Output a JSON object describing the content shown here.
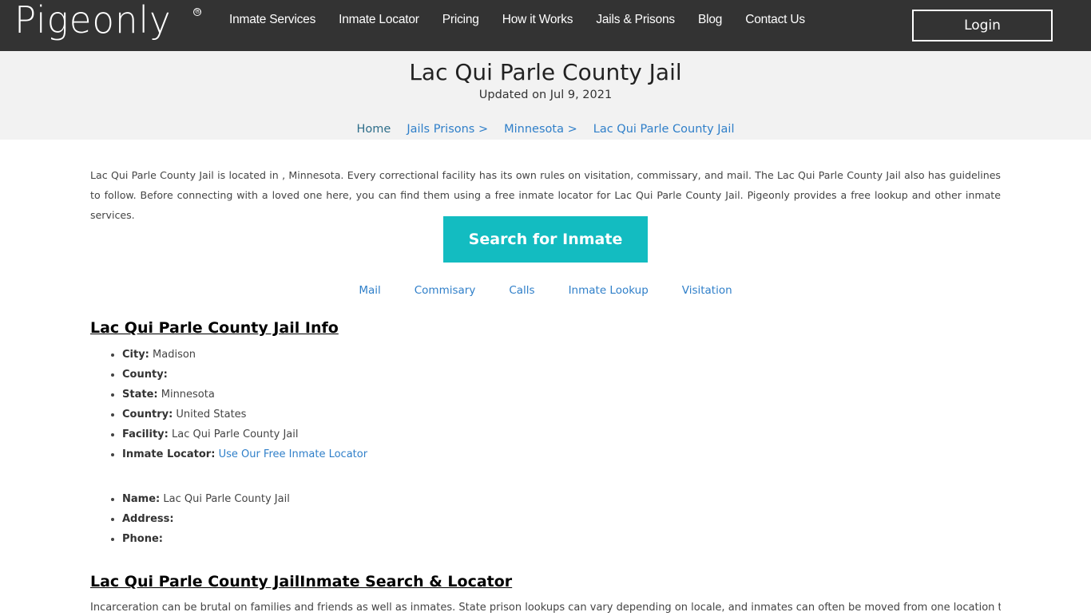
{
  "nav": {
    "logo": "Pigeonly",
    "logo_mark": "®",
    "links": [
      "Inmate Services",
      "Inmate Locator",
      "Pricing",
      "How it Works",
      "Jails & Prisons",
      "Blog",
      "Contact Us"
    ],
    "login_label": "Login"
  },
  "hero": {
    "title": "Lac Qui Parle County Jail",
    "updated": "Updated on Jul 9, 2021",
    "breadcrumb": [
      "Home",
      "Jails Prisons >",
      "Minnesota >",
      "Lac Qui Parle County Jail"
    ]
  },
  "intro": "Lac Qui Parle County Jail is located in , Minnesota. Every correctional facility has its own rules on visitation, commissary, and mail. The Lac Qui Parle County Jail also has guidelines to follow. Before connecting with a loved one here, you can find them using a free inmate locator for Lac Qui Parle County Jail. Pigeonly provides a free lookup and other inmate services.",
  "search_button": "Search for Inmate",
  "sub_links": [
    "Mail",
    "Commisary",
    "Calls",
    "Inmate Lookup",
    "Visitation"
  ],
  "info": {
    "title": "Lac Qui Parle County Jail Info",
    "items": [
      {
        "label": "City:",
        "value": "Madison"
      },
      {
        "label": "County:",
        "value": ""
      },
      {
        "label": "State:",
        "value": "Minnesota"
      },
      {
        "label": "Country:",
        "value": "United States"
      },
      {
        "label": "Facility:",
        "value": "Lac Qui Parle County Jail"
      },
      {
        "label": "Inmate Locator:",
        "link": "Use Our Free Inmate Locator"
      }
    ],
    "contact": [
      {
        "label": "Name:",
        "value": "Lac Qui Parle County Jail"
      },
      {
        "label": "Address:",
        "value": ""
      },
      {
        "label": "Phone:",
        "value": ""
      }
    ]
  },
  "search_section": {
    "title": "Lac Qui Parle County JailInmate Search & Locator",
    "text": "Incarceration can be brutal on families and friends as well as inmates. State prison lookups can vary depending on locale, and inmates can often be moved from one location to another"
  }
}
